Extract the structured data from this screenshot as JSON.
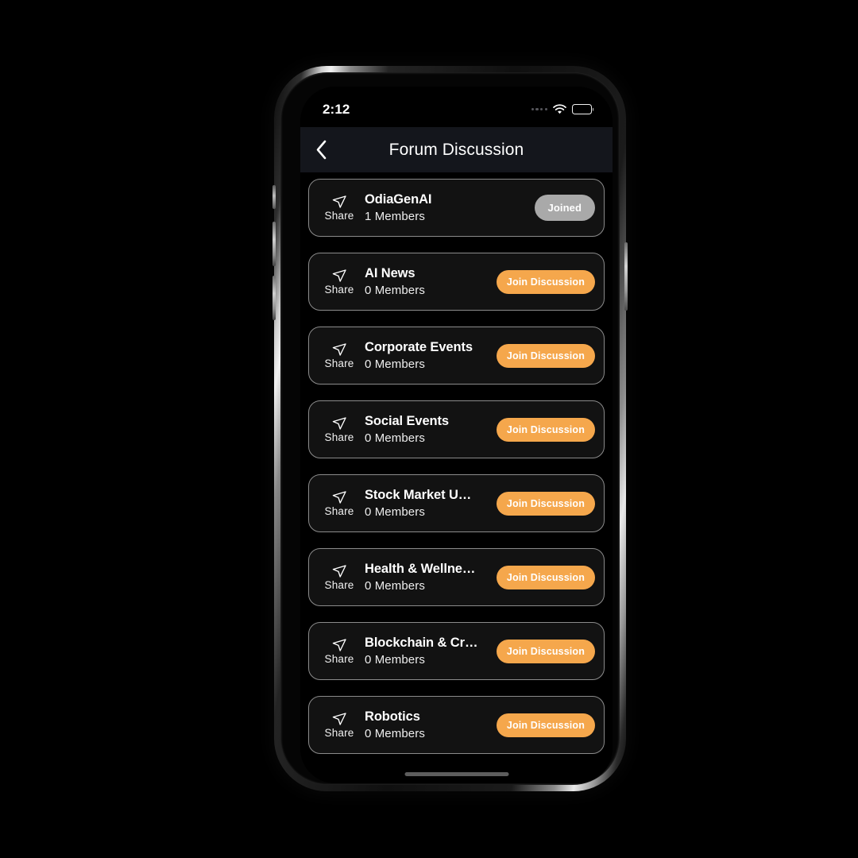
{
  "status_bar": {
    "time": "2:12",
    "signal_icon": "signal-dots-icon",
    "wifi_icon": "wifi-icon",
    "battery_icon": "battery-full-icon"
  },
  "header": {
    "back_icon": "chevron-left-icon",
    "title": "Forum Discussion"
  },
  "colors": {
    "accent_orange": "#f5a74c",
    "joined_gray": "#a9a9a9",
    "card_bg": "#121212",
    "card_border": "#8b8b8b",
    "navbar_bg": "#14161c",
    "screen_bg": "#000000"
  },
  "list": {
    "share_label": "Share",
    "share_icon": "send-share-icon",
    "cards": [
      {
        "name": "OdiaGenAI",
        "members": "1 Members",
        "action": "Joined",
        "state": "joined"
      },
      {
        "name": "AI News",
        "members": "0 Members",
        "action": "Join Discussion",
        "state": "join"
      },
      {
        "name": "Corporate Events",
        "members": "0 Members",
        "action": "Join Discussion",
        "state": "join"
      },
      {
        "name": "Social Events",
        "members": "0 Members",
        "action": "Join Discussion",
        "state": "join"
      },
      {
        "name": "Stock Market U…",
        "members": "0 Members",
        "action": "Join Discussion",
        "state": "join"
      },
      {
        "name": "Health & Wellne…",
        "members": "0 Members",
        "action": "Join Discussion",
        "state": "join"
      },
      {
        "name": "Blockchain & Cr…",
        "members": "0 Members",
        "action": "Join Discussion",
        "state": "join"
      },
      {
        "name": "Robotics",
        "members": "0 Members",
        "action": "Join Discussion",
        "state": "join"
      }
    ]
  },
  "home_indicator": "home-indicator-bar"
}
